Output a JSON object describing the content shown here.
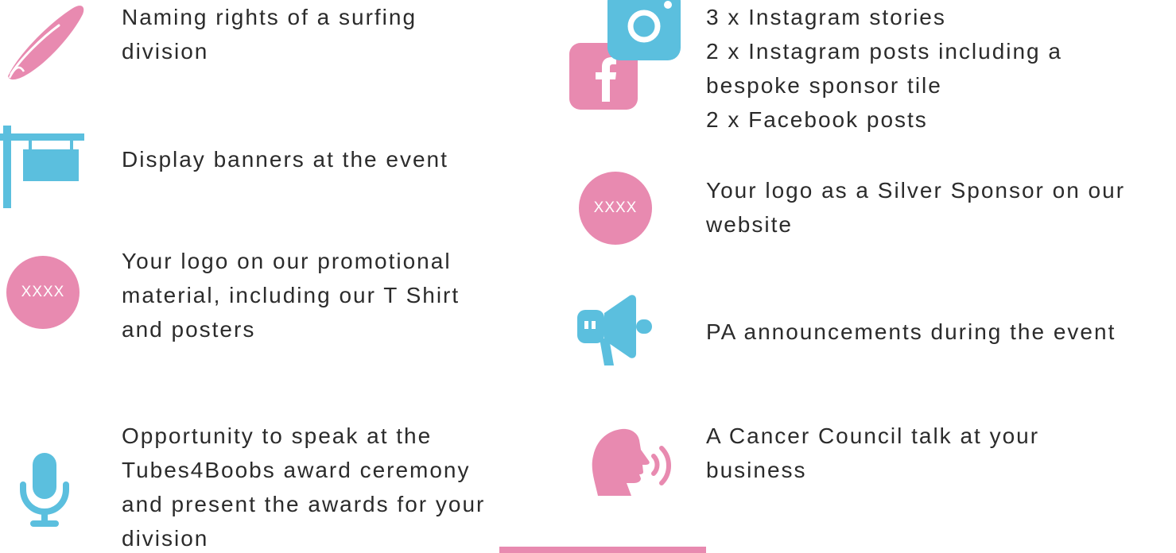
{
  "colors": {
    "pink": "#e88ab0",
    "blue": "#5bbfde",
    "text": "#2b2b2b"
  },
  "left_items": [
    {
      "icon": "surfboard-icon",
      "lines": [
        "Naming rights of a surfing",
        "division"
      ]
    },
    {
      "icon": "banner-sign-icon",
      "lines": [
        "Display banners at the event"
      ]
    },
    {
      "icon": "logo-placeholder-icon",
      "badge": "XXXX",
      "lines": [
        "Your logo on our promotional",
        "material, including our T Shirt",
        "and posters"
      ]
    },
    {
      "icon": "microphone-icon",
      "lines": [
        "Opportunity to speak at the",
        "Tubes4Boobs award ceremony",
        "and present the awards for your",
        "division"
      ]
    }
  ],
  "right_items": [
    {
      "icon": "instagram-facebook-icon",
      "lines": [
        "3 x Instagram stories",
        "2 x Instagram posts including a",
        "bespoke sponsor tile",
        "2 x Facebook posts"
      ]
    },
    {
      "icon": "logo-placeholder-icon",
      "badge": "XXXX",
      "lines": [
        "Your logo as a Silver Sponsor on our",
        "website"
      ]
    },
    {
      "icon": "megaphone-icon",
      "lines": [
        "PA announcements during the event"
      ]
    },
    {
      "icon": "speaking-head-icon",
      "lines": [
        "A Cancer Council talk at your",
        "business"
      ]
    }
  ]
}
